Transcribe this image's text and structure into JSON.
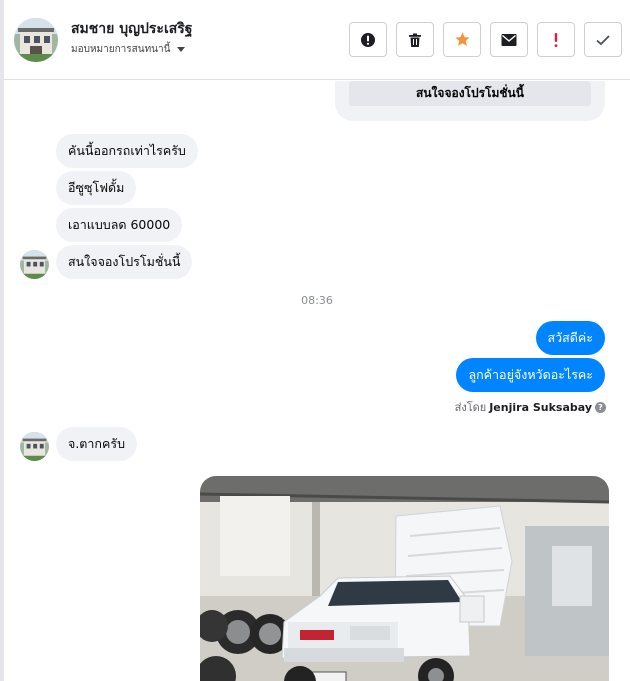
{
  "header": {
    "contact_name": "สมชาย บุญประเสริฐ",
    "assign_label": "มอบหมายการสนทนานี้",
    "avatar_icon": "house-photo-avatar",
    "actions": [
      {
        "name": "report-spam-button",
        "icon": "exclamation-circle-icon"
      },
      {
        "name": "delete-button",
        "icon": "trash-icon"
      },
      {
        "name": "star-button",
        "icon": "star-icon",
        "color": "#f7923a"
      },
      {
        "name": "mark-unread-button",
        "icon": "envelope-icon"
      },
      {
        "name": "follow-up-button",
        "icon": "exclamation-icon",
        "color": "#e41e3f"
      },
      {
        "name": "mark-done-button",
        "icon": "check-icon"
      }
    ]
  },
  "chat": {
    "prev_card_button": "สนใจจองโปรโมชั่นนี้",
    "incoming_1": [
      "คันนี้ออกรถเท่าไรครับ",
      "อีซูซุโฟดั้ม",
      "เอาแบบลด 60000",
      "สนใจจองโปรโมชั่นนี้"
    ],
    "timestamp": "08:36",
    "outgoing": [
      "สวัสดีค่ะ",
      "ลูกค้าอยู่จังหวัดอะไรคะ"
    ],
    "sent_by_prefix": "ส่งโดย",
    "sent_by_name": "Jenjira Suksabay",
    "incoming_2": "จ.ตากครับ",
    "photo_icon": "isuzu-dump-truck-photo"
  },
  "colors": {
    "outgoing_bubble": "#0084ff",
    "incoming_bubble": "#f0f2f5",
    "star": "#f7923a",
    "alert": "#e41e3f"
  }
}
